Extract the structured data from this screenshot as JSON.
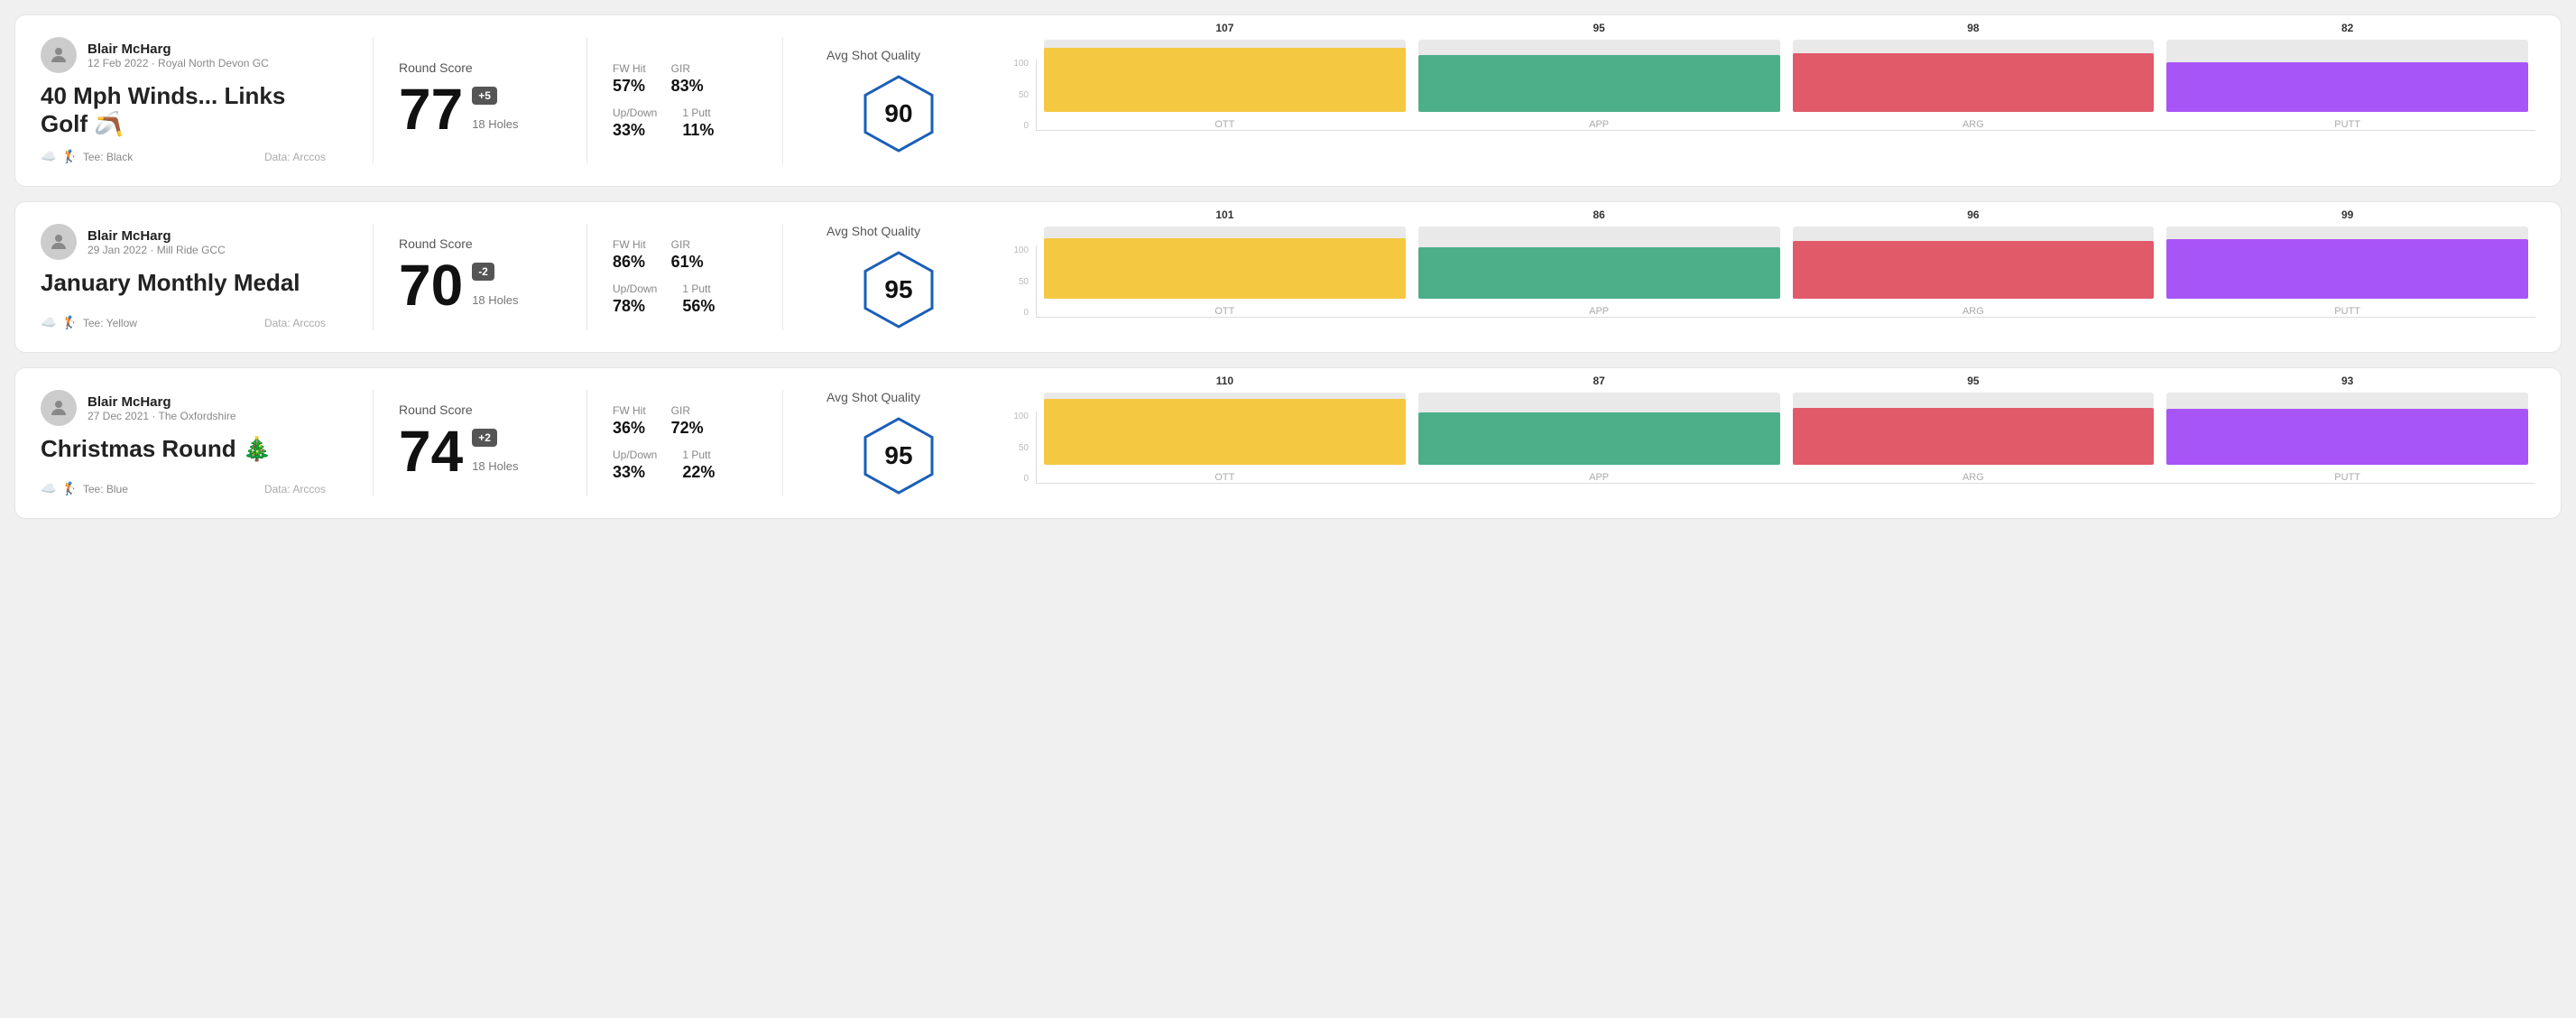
{
  "rounds": [
    {
      "id": "round1",
      "user_name": "Blair McHarg",
      "user_meta": "12 Feb 2022 · Royal North Devon GC",
      "round_title": "40 Mph Winds... Links Golf 🪃",
      "tee": "Tee: Black",
      "data_source": "Data: Arccos",
      "score": "77",
      "score_diff": "+5",
      "score_diff_type": "positive",
      "holes": "18 Holes",
      "fw_hit": "57%",
      "gir": "83%",
      "up_down": "33%",
      "one_putt": "11%",
      "avg_quality": "90",
      "chart": {
        "bars": [
          {
            "label": "OTT",
            "value": 107,
            "color": "#f5c842"
          },
          {
            "label": "APP",
            "value": 95,
            "color": "#4caf8a"
          },
          {
            "label": "ARG",
            "value": 98,
            "color": "#e05a6a"
          },
          {
            "label": "PUTT",
            "value": 82,
            "color": "#a855f7"
          }
        ],
        "max": 120
      }
    },
    {
      "id": "round2",
      "user_name": "Blair McHarg",
      "user_meta": "29 Jan 2022 · Mill Ride GCC",
      "round_title": "January Monthly Medal",
      "tee": "Tee: Yellow",
      "data_source": "Data: Arccos",
      "score": "70",
      "score_diff": "-2",
      "score_diff_type": "negative",
      "holes": "18 Holes",
      "fw_hit": "86%",
      "gir": "61%",
      "up_down": "78%",
      "one_putt": "56%",
      "avg_quality": "95",
      "chart": {
        "bars": [
          {
            "label": "OTT",
            "value": 101,
            "color": "#f5c842"
          },
          {
            "label": "APP",
            "value": 86,
            "color": "#4caf8a"
          },
          {
            "label": "ARG",
            "value": 96,
            "color": "#e05a6a"
          },
          {
            "label": "PUTT",
            "value": 99,
            "color": "#a855f7"
          }
        ],
        "max": 120
      }
    },
    {
      "id": "round3",
      "user_name": "Blair McHarg",
      "user_meta": "27 Dec 2021 · The Oxfordshire",
      "round_title": "Christmas Round 🎄",
      "tee": "Tee: Blue",
      "data_source": "Data: Arccos",
      "score": "74",
      "score_diff": "+2",
      "score_diff_type": "positive",
      "holes": "18 Holes",
      "fw_hit": "36%",
      "gir": "72%",
      "up_down": "33%",
      "one_putt": "22%",
      "avg_quality": "95",
      "chart": {
        "bars": [
          {
            "label": "OTT",
            "value": 110,
            "color": "#f5c842"
          },
          {
            "label": "APP",
            "value": 87,
            "color": "#4caf8a"
          },
          {
            "label": "ARG",
            "value": 95,
            "color": "#e05a6a"
          },
          {
            "label": "PUTT",
            "value": 93,
            "color": "#a855f7"
          }
        ],
        "max": 120
      }
    }
  ],
  "labels": {
    "round_score": "Round Score",
    "fw_hit": "FW Hit",
    "gir": "GIR",
    "up_down": "Up/Down",
    "one_putt": "1 Putt",
    "avg_quality": "Avg Shot Quality",
    "data_arccos": "Data: Arccos",
    "chart_y_100": "100",
    "chart_y_50": "50",
    "chart_y_0": "0"
  }
}
